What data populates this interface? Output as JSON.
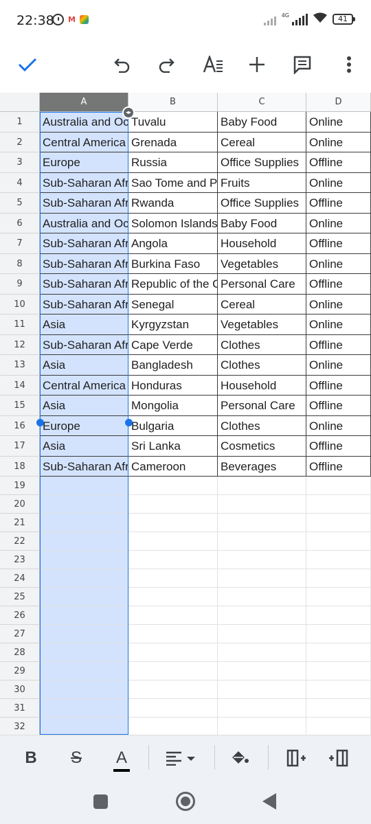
{
  "status_bar": {
    "time": "22:38",
    "network": "4G",
    "battery": "41",
    "icons": [
      "alarm-icon",
      "gmail-icon",
      "photos-icon",
      "signal-icon",
      "wifi-icon",
      "battery-icon"
    ]
  },
  "toolbar": {
    "icons": [
      "checkmark-icon",
      "undo-icon",
      "redo-icon",
      "text-format-icon",
      "add-icon",
      "comment-icon",
      "more-vert-icon"
    ]
  },
  "colors": {
    "accent": "#1a73e8",
    "selection_fill": "#d3e3fd",
    "selected_header": "#747775"
  },
  "sheet": {
    "columns": [
      "A",
      "B",
      "C",
      "D"
    ],
    "selected_column": "A",
    "row_numbers": [
      "1",
      "2",
      "3",
      "4",
      "5",
      "6",
      "7",
      "8",
      "9",
      "10",
      "11",
      "12",
      "13",
      "14",
      "15",
      "16",
      "17",
      "18",
      "19",
      "20",
      "21",
      "22",
      "23",
      "24",
      "25",
      "26",
      "27",
      "28",
      "29",
      "30",
      "31",
      "32"
    ],
    "rows": [
      [
        "Australia and Oce",
        "Tuvalu",
        "Baby Food",
        "Online"
      ],
      [
        "Central America a",
        "Grenada",
        "Cereal",
        "Online"
      ],
      [
        "Europe",
        "Russia",
        "Office Supplies",
        "Offline"
      ],
      [
        "Sub-Saharan Afric",
        "Sao Tome and Pri",
        "Fruits",
        "Online"
      ],
      [
        "Sub-Saharan Afric",
        "Rwanda",
        "Office Supplies",
        "Offline"
      ],
      [
        "Australia and Oce",
        "Solomon Islands",
        "Baby Food",
        "Online"
      ],
      [
        "Sub-Saharan Afric",
        "Angola",
        "Household",
        "Offline"
      ],
      [
        "Sub-Saharan Afric",
        "Burkina Faso",
        "Vegetables",
        "Online"
      ],
      [
        "Sub-Saharan Afric",
        "Republic of the Co",
        "Personal Care",
        "Offline"
      ],
      [
        "Sub-Saharan Afric",
        "Senegal",
        "Cereal",
        "Online"
      ],
      [
        "Asia",
        "Kyrgyzstan",
        "Vegetables",
        "Online"
      ],
      [
        "Sub-Saharan Afric",
        "Cape Verde",
        "Clothes",
        "Offline"
      ],
      [
        "Asia",
        "Bangladesh",
        "Clothes",
        "Online"
      ],
      [
        "Central America a",
        "Honduras",
        "Household",
        "Offline"
      ],
      [
        "Asia",
        "Mongolia",
        "Personal Care",
        "Offline"
      ],
      [
        "Europe",
        "Bulgaria",
        "Clothes",
        "Online"
      ],
      [
        "Asia",
        "Sri Lanka",
        "Cosmetics",
        "Offline"
      ],
      [
        "Sub-Saharan Afric",
        "Cameroon",
        "Beverages",
        "Offline"
      ]
    ]
  },
  "format_bar": {
    "bold_label": "B",
    "strike_label": "S",
    "text_color_label": "A",
    "icons": [
      "bold-icon",
      "strikethrough-icon",
      "text-color-icon",
      "align-icon",
      "fill-color-icon",
      "insert-column-left-icon",
      "insert-column-right-icon"
    ]
  },
  "nav_bar": {
    "icons": [
      "recents-icon",
      "home-icon",
      "back-icon"
    ]
  }
}
